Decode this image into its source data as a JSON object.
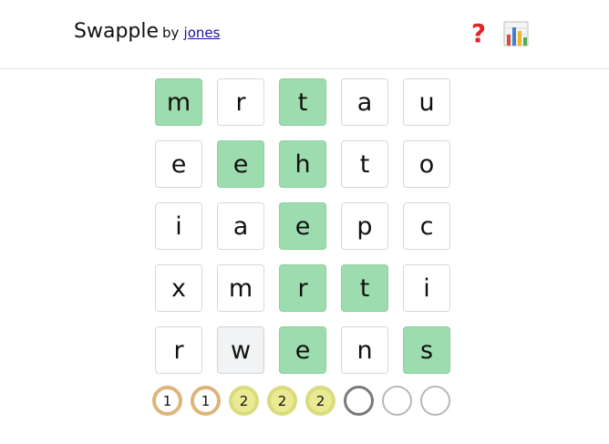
{
  "header": {
    "title": "Swapple",
    "by_label": "by",
    "author": "jones",
    "help_icon": "question-mark-icon",
    "stats_icon": "bar-chart-icon"
  },
  "board": {
    "rows": [
      [
        {
          "letter": "m",
          "state": "correct"
        },
        {
          "letter": "r",
          "state": "default"
        },
        {
          "letter": "t",
          "state": "correct"
        },
        {
          "letter": "a",
          "state": "default"
        },
        {
          "letter": "u",
          "state": "default"
        }
      ],
      [
        {
          "letter": "e",
          "state": "default"
        },
        {
          "letter": "e",
          "state": "correct"
        },
        {
          "letter": "h",
          "state": "correct"
        },
        {
          "letter": "t",
          "state": "default"
        },
        {
          "letter": "o",
          "state": "default"
        }
      ],
      [
        {
          "letter": "i",
          "state": "default"
        },
        {
          "letter": "a",
          "state": "default"
        },
        {
          "letter": "e",
          "state": "correct"
        },
        {
          "letter": "p",
          "state": "default"
        },
        {
          "letter": "c",
          "state": "default"
        }
      ],
      [
        {
          "letter": "x",
          "state": "default"
        },
        {
          "letter": "m",
          "state": "default"
        },
        {
          "letter": "r",
          "state": "correct"
        },
        {
          "letter": "t",
          "state": "correct"
        },
        {
          "letter": "i",
          "state": "default"
        }
      ],
      [
        {
          "letter": "r",
          "state": "default"
        },
        {
          "letter": "w",
          "state": "selected"
        },
        {
          "letter": "e",
          "state": "correct"
        },
        {
          "letter": "n",
          "state": "default"
        },
        {
          "letter": "s",
          "state": "correct"
        }
      ]
    ],
    "colors": {
      "correct": "#9ddcae",
      "selected": "#f1f3f5",
      "default": "#ffffff"
    }
  },
  "attempts": [
    {
      "label": "1",
      "state": "lvl1"
    },
    {
      "label": "1",
      "state": "lvl1"
    },
    {
      "label": "2",
      "state": "lvl2"
    },
    {
      "label": "2",
      "state": "lvl2"
    },
    {
      "label": "2",
      "state": "lvl2"
    },
    {
      "label": "",
      "state": "current"
    },
    {
      "label": "",
      "state": "empty"
    },
    {
      "label": "",
      "state": "empty"
    }
  ]
}
